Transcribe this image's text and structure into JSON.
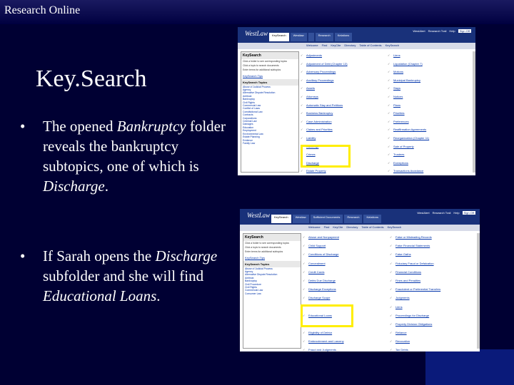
{
  "header_title": "Research Online",
  "slide_title": "Key.Search",
  "bullets": [
    {
      "segments": [
        {
          "text": "The opened ",
          "italic": false
        },
        {
          "text": "Bankruptcy",
          "italic": true
        },
        {
          "text": " folder reveals the bankruptcy subtopics, one of which is ",
          "italic": false
        },
        {
          "text": "Discharge",
          "italic": true
        },
        {
          "text": ".",
          "italic": false
        }
      ]
    },
    {
      "segments": [
        {
          "text": "If Sarah opens the ",
          "italic": false
        },
        {
          "text": "Discharge",
          "italic": true
        },
        {
          "text": " subfolder and she will find ",
          "italic": false
        },
        {
          "text": "Educational Loans",
          "italic": true
        },
        {
          "text": ".",
          "italic": false
        }
      ]
    }
  ],
  "colors": {
    "background": "#000033",
    "highlight": "#ffee00",
    "westlaw_blue": "#19317a"
  },
  "screenshots": [
    {
      "logo": "WestLaw",
      "tabs": [
        "KeySearch",
        "Westlaw",
        "",
        "Research",
        "Kelations"
      ],
      "toplinks": [
        "WestAlert",
        "Research Trail",
        "Help",
        "Sign Off"
      ],
      "nav": [
        "Welcome",
        "Find",
        "KeyCite",
        "Directory",
        "Table of Contents",
        "KeySearch"
      ],
      "left_title": "KeySearch",
      "left_text": [
        "Click a folder to see corresponding topics",
        "Click a topic to search documents",
        "Enter terms for additional subtopics"
      ],
      "left_link": "KeySearch Tips",
      "left_topics_title": "KeySearch Topics",
      "left_items": [
        "Abuse of Judicial Process",
        "Agency",
        "Alternative Dispute Resolution",
        "Antitrust",
        "Bankruptcy",
        "Civil Rights",
        "Commercial Law",
        "Conflict of Laws",
        "Constitutional Law",
        "Contracts",
        "Corporations",
        "Criminal Law",
        "Damages",
        "Education",
        "Employment",
        "Environmental Law",
        "Estate Planning",
        "Evidence",
        "Family Law"
      ],
      "col1": [
        "Adjustments",
        "Adjustment of Debt (Chapter 13)",
        "Adversary Proceedings",
        "Ancillary Proceedings",
        "Assets",
        "Attorneys",
        "Automatic Stay and Petitions",
        "Business Bankruptcy",
        "Case Administration",
        "Claims and Priorities",
        "Liability",
        "Contempt",
        "Crimes",
        "Discharge",
        "Estate Property"
      ],
      "col2": [
        "Liens",
        "Liquidation (Chapter 7)",
        "Motions",
        "Municipal Bankruptcy",
        "Stays",
        "Notices",
        "Plans",
        "Priorities",
        "Preferences",
        "Reaffirmation Agreements",
        "Reorganization (Chapter 11)",
        "Sale of Property",
        "Trustees",
        "Exemptions",
        "Transactions Avoidance"
      ]
    },
    {
      "logo": "WestLaw",
      "tabs": [
        "KeySearch",
        "Westlaw",
        "Sufficient Documents",
        "Research",
        "Kelations"
      ],
      "toplinks": [
        "WestAlert",
        "Research Trail",
        "Help",
        "Sign Off"
      ],
      "nav": [
        "Welcome",
        "Find",
        "KeyCite",
        "Directory",
        "Table of Contents",
        "KeySearch"
      ],
      "left_title": "KeySearch",
      "left_text": [
        "Click a folder to see corresponding topics",
        "Click a topic to search documents",
        "Enter terms for additional subtopics"
      ],
      "left_link": "KeySearch Tips",
      "left_topics_title": "KeySearch Topics",
      "left_items": [
        "Abuse of Judicial Process",
        "Agency",
        "Alternative Dispute Resolution",
        "Antitrust",
        "Bankruptcy",
        "Civil Procedure",
        "Civil Rights",
        "Commercial Law",
        "Consumer Law"
      ],
      "col1": [
        "Abuse and Nonpayment",
        "Child Support",
        "Conditions of Discharge",
        "Concealment",
        "Credit Cards",
        "Debts Due Discharge",
        "Discharge Exceptions",
        "Discharge Scope",
        "",
        "Educational Loans",
        "",
        "Eligibility of Debtor",
        "Embezzlement and Larceny",
        "Fraud and Judgments"
      ],
      "col2": [
        "False or Misleading Records",
        "False Financial Statements",
        "False Oaths",
        "Fiduciary Fraud or Defalcation",
        "Financial Conditions",
        "Fines and Penalties",
        "Fraudulent or Preferential Transfers",
        "Judgments",
        "Liens",
        "Proceedings for Discharge",
        "Property Division Obligations",
        "Reliance",
        "Revocation",
        "Tax Debts"
      ]
    }
  ]
}
